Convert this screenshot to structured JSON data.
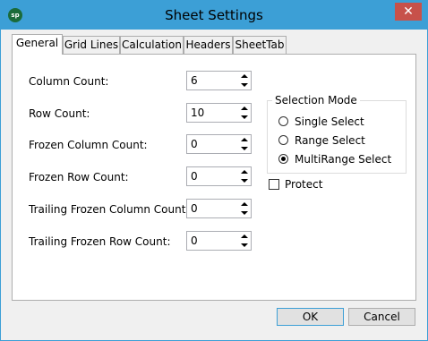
{
  "window": {
    "title": "Sheet Settings",
    "app_icon_text": "sp",
    "close_glyph": "✕",
    "accent_color": "#3c9fd6",
    "close_color": "#c7514a"
  },
  "tabs": [
    {
      "label": "General",
      "active": true
    },
    {
      "label": "Grid Lines",
      "active": false
    },
    {
      "label": "Calculation",
      "active": false
    },
    {
      "label": "Headers",
      "active": false
    },
    {
      "label": "SheetTab",
      "active": false
    }
  ],
  "fields": [
    {
      "label": "Column Count:",
      "value": "6"
    },
    {
      "label": "Row Count:",
      "value": "10"
    },
    {
      "label": "Frozen Column Count:",
      "value": "0"
    },
    {
      "label": "Frozen Row Count:",
      "value": "0"
    },
    {
      "label": "Trailing Frozen Column Count:",
      "value": "0"
    },
    {
      "label": "Trailing Frozen Row Count:",
      "value": "0"
    }
  ],
  "selection_mode": {
    "title": "Selection Mode",
    "options": [
      {
        "label": "Single Select",
        "selected": false
      },
      {
        "label": "Range Select",
        "selected": false
      },
      {
        "label": "MultiRange Select",
        "selected": true
      }
    ]
  },
  "protect": {
    "label": "Protect",
    "checked": false
  },
  "buttons": {
    "ok": "OK",
    "cancel": "Cancel"
  }
}
